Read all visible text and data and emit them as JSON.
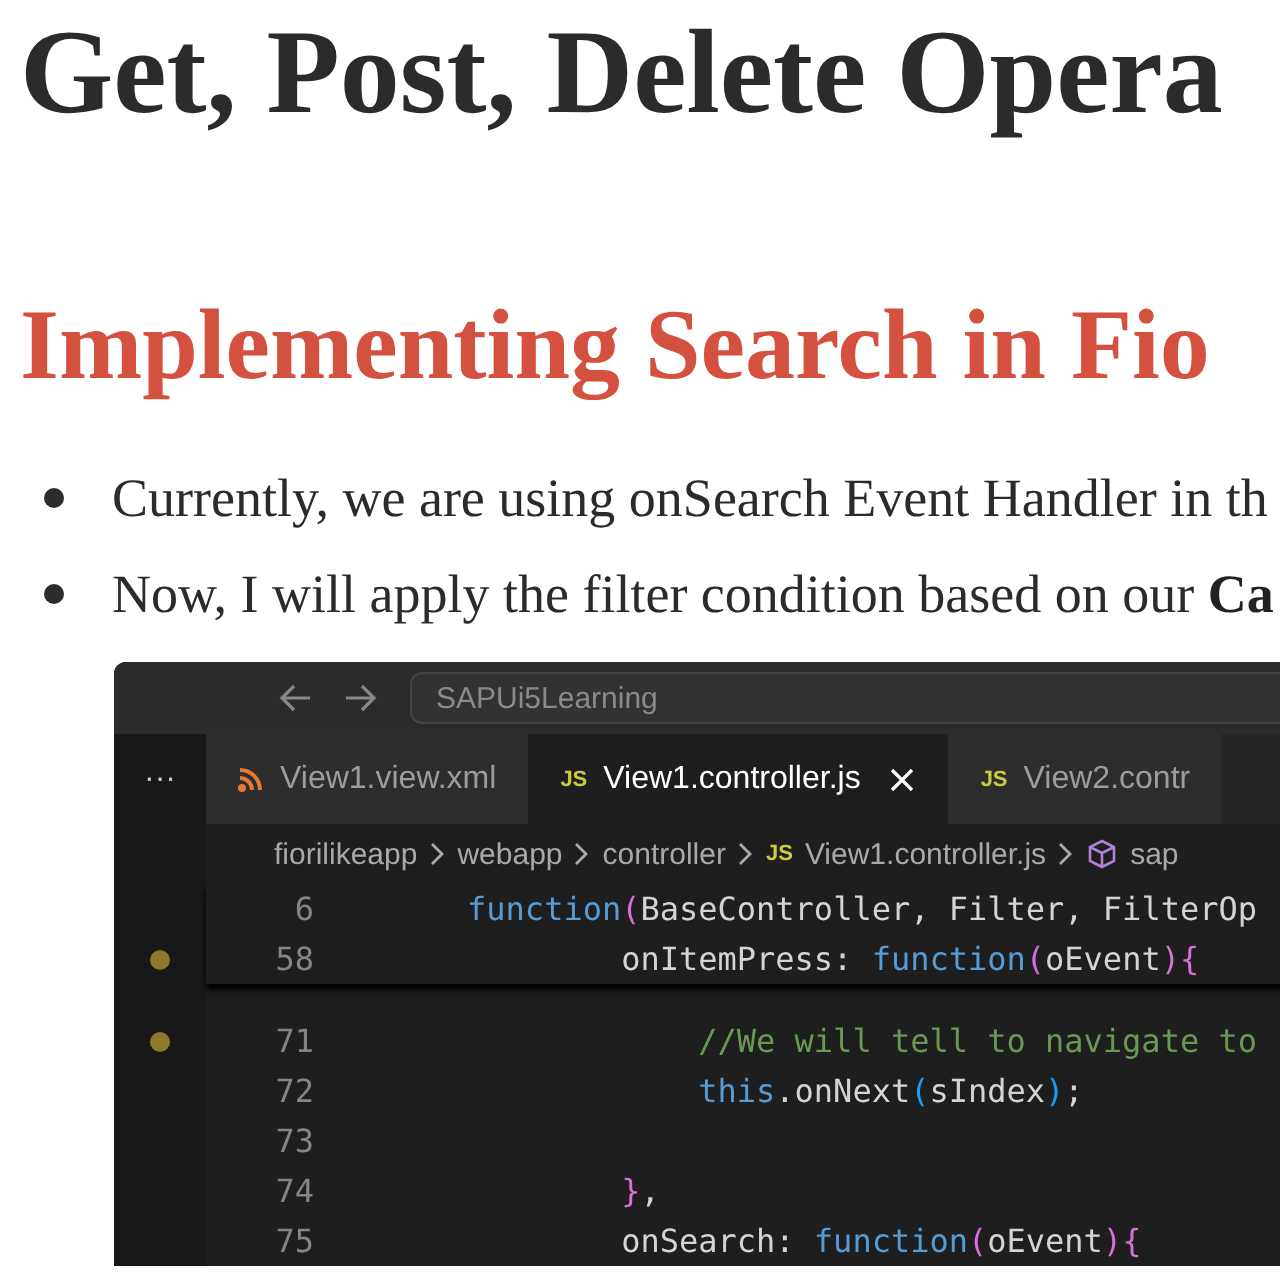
{
  "heading": "Get, Post, Delete Opera",
  "section_heading": "Implementing Search in Fio",
  "bullets": [
    "Currently, we are using onSearch Event Handler in th",
    "Now, I will apply the filter condition based on our **Ca**"
  ],
  "editor": {
    "search_box": "SAPUi5Learning",
    "more": "···",
    "tabs": [
      {
        "label": "View1.view.xml",
        "kind": "xml",
        "selected": false
      },
      {
        "label": "View1.controller.js",
        "kind": "js",
        "badge": "JS",
        "selected": true
      },
      {
        "label": "View2.contr",
        "kind": "js",
        "badge": "JS",
        "selected": false
      }
    ],
    "breadcrumbs": [
      {
        "label": "fiorilikeapp",
        "kind": "folder"
      },
      {
        "label": "webapp",
        "kind": "folder"
      },
      {
        "label": "controller",
        "kind": "folder"
      },
      {
        "label": "View1.controller.js",
        "kind": "js",
        "badge": "JS"
      },
      {
        "label": "sap",
        "kind": "symbol"
      }
    ],
    "sticky_lines": [
      {
        "number": "6",
        "marker": false,
        "tokens": [
          {
            "text": "    function",
            "kind": "keyword"
          },
          {
            "text": "(",
            "kind": "bracket2"
          },
          {
            "text": "BaseController, Filter, FilterOp",
            "kind": "plain"
          }
        ]
      },
      {
        "number": "58",
        "marker": true,
        "tokens": [
          {
            "text": "            onItemPress: ",
            "kind": "plain"
          },
          {
            "text": "function",
            "kind": "keyword"
          },
          {
            "text": "(",
            "kind": "bracket2"
          },
          {
            "text": "oEvent",
            "kind": "plain"
          },
          {
            "text": ")",
            "kind": "bracket2"
          },
          {
            "text": "{",
            "kind": "bracket2"
          }
        ]
      }
    ],
    "lines": [
      {
        "number": "71",
        "marker": true,
        "tokens": [
          {
            "text": "                //We will tell to navigate to",
            "kind": "comment"
          }
        ]
      },
      {
        "number": "72",
        "marker": false,
        "tokens": [
          {
            "text": "                this",
            "kind": "keyword"
          },
          {
            "text": ".onNext",
            "kind": "plain"
          },
          {
            "text": "(",
            "kind": "bracket3"
          },
          {
            "text": "sIndex",
            "kind": "plain"
          },
          {
            "text": ")",
            "kind": "bracket3"
          },
          {
            "text": ";",
            "kind": "plain"
          }
        ]
      },
      {
        "number": "73",
        "marker": false
      },
      {
        "number": "74",
        "marker": false,
        "tokens": [
          {
            "text": "            }",
            "kind": "bracket2"
          },
          {
            "text": ",",
            "kind": "plain"
          }
        ]
      },
      {
        "number": "75",
        "marker": false,
        "tokens": [
          {
            "text": "            onSearch: ",
            "kind": "plain"
          },
          {
            "text": "function",
            "kind": "keyword"
          },
          {
            "text": "(",
            "kind": "bracket2"
          },
          {
            "text": "oEvent",
            "kind": "plain"
          },
          {
            "text": ")",
            "kind": "bracket2"
          },
          {
            "text": "{",
            "kind": "bracket2"
          }
        ]
      }
    ]
  }
}
